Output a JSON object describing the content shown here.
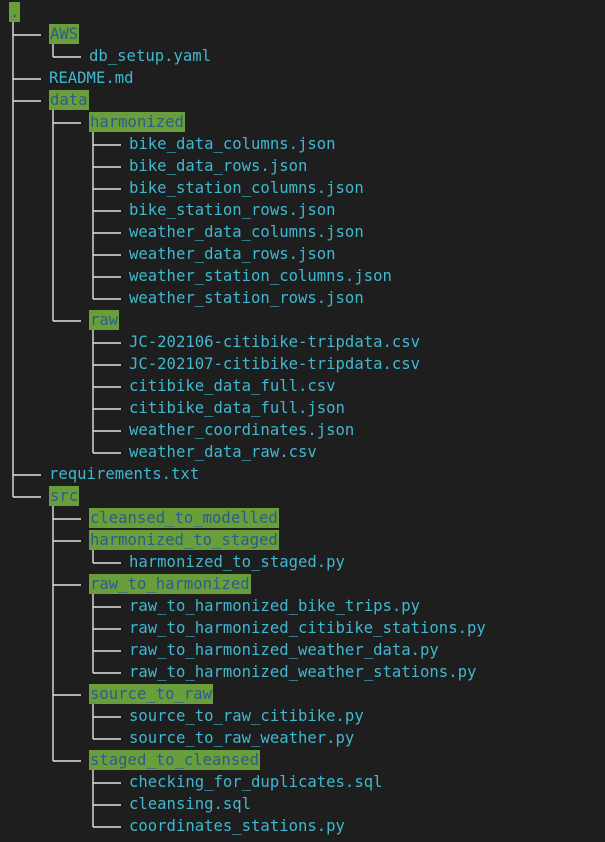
{
  "colors": {
    "background": "#1e1e1e",
    "file_text": "#3fb8d0",
    "dir_highlight": "#6a9e3a",
    "dir_text": "#2a5e8a",
    "tree_lines": "#e0e0e0"
  },
  "tree": {
    "name": ".",
    "type": "root",
    "children": [
      {
        "name": "AWS",
        "type": "dir",
        "children": [
          {
            "name": "db_setup.yaml",
            "type": "file"
          }
        ]
      },
      {
        "name": "README.md",
        "type": "file"
      },
      {
        "name": "data",
        "type": "dir",
        "children": [
          {
            "name": "harmonized",
            "type": "dir",
            "children": [
              {
                "name": "bike_data_columns.json",
                "type": "file"
              },
              {
                "name": "bike_data_rows.json",
                "type": "file"
              },
              {
                "name": "bike_station_columns.json",
                "type": "file"
              },
              {
                "name": "bike_station_rows.json",
                "type": "file"
              },
              {
                "name": "weather_data_columns.json",
                "type": "file"
              },
              {
                "name": "weather_data_rows.json",
                "type": "file"
              },
              {
                "name": "weather_station_columns.json",
                "type": "file"
              },
              {
                "name": "weather_station_rows.json",
                "type": "file"
              }
            ]
          },
          {
            "name": "raw",
            "type": "dir",
            "children": [
              {
                "name": "JC-202106-citibike-tripdata.csv",
                "type": "file"
              },
              {
                "name": "JC-202107-citibike-tripdata.csv",
                "type": "file"
              },
              {
                "name": "citibike_data_full.csv",
                "type": "file"
              },
              {
                "name": "citibike_data_full.json",
                "type": "file"
              },
              {
                "name": "weather_coordinates.json",
                "type": "file"
              },
              {
                "name": "weather_data_raw.csv",
                "type": "file"
              }
            ]
          }
        ]
      },
      {
        "name": "requirements.txt",
        "type": "file"
      },
      {
        "name": "src",
        "type": "dir",
        "children": [
          {
            "name": "cleansed_to_modelled",
            "type": "dir",
            "children": []
          },
          {
            "name": "harmonized_to_staged",
            "type": "dir",
            "children": [
              {
                "name": "harmonized_to_staged.py",
                "type": "file"
              }
            ]
          },
          {
            "name": "raw_to_harmonized",
            "type": "dir",
            "children": [
              {
                "name": "raw_to_harmonized_bike_trips.py",
                "type": "file"
              },
              {
                "name": "raw_to_harmonized_citibike_stations.py",
                "type": "file"
              },
              {
                "name": "raw_to_harmonized_weather_data.py",
                "type": "file"
              },
              {
                "name": "raw_to_harmonized_weather_stations.py",
                "type": "file"
              }
            ]
          },
          {
            "name": "source_to_raw",
            "type": "dir",
            "children": [
              {
                "name": "source_to_raw_citibike.py",
                "type": "file"
              },
              {
                "name": "source_to_raw_weather.py",
                "type": "file"
              }
            ]
          },
          {
            "name": "staged_to_cleansed",
            "type": "dir",
            "children": [
              {
                "name": "checking_for_duplicates.sql",
                "type": "file"
              },
              {
                "name": "cleansing.sql",
                "type": "file"
              },
              {
                "name": "coordinates_stations.py",
                "type": "file"
              }
            ]
          }
        ]
      }
    ]
  }
}
